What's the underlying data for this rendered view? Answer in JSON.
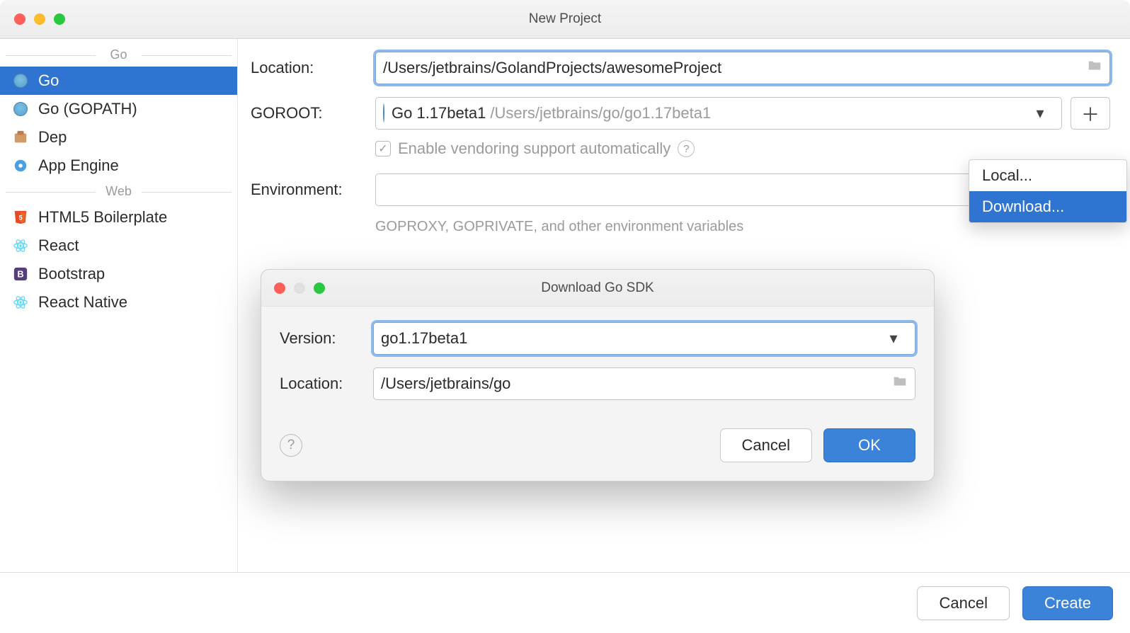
{
  "window": {
    "title": "New Project"
  },
  "sidebar": {
    "groups": [
      {
        "label": "Go",
        "items": [
          {
            "label": "Go",
            "icon": "gopher-icon",
            "selected": true
          },
          {
            "label": "Go (GOPATH)",
            "icon": "gopher-icon"
          },
          {
            "label": "Dep",
            "icon": "dep-icon"
          },
          {
            "label": "App Engine",
            "icon": "appengine-icon"
          }
        ]
      },
      {
        "label": "Web",
        "items": [
          {
            "label": "HTML5 Boilerplate",
            "icon": "html5-icon"
          },
          {
            "label": "React",
            "icon": "react-icon"
          },
          {
            "label": "Bootstrap",
            "icon": "bootstrap-icon"
          },
          {
            "label": "React Native",
            "icon": "react-icon"
          }
        ]
      }
    ]
  },
  "form": {
    "location_label": "Location:",
    "location_value": "/Users/jetbrains/GolandProjects/awesomeProject",
    "goroot_label": "GOROOT:",
    "goroot_value": "Go 1.17beta1",
    "goroot_path": "/Users/jetbrains/go/go1.17beta1",
    "vendoring_label": "Enable vendoring support automatically",
    "environment_label": "Environment:",
    "environment_value": "",
    "env_hint": "GOPROXY, GOPRIVATE, and other environment variables"
  },
  "add_menu": {
    "items": [
      {
        "label": "Local...",
        "selected": false
      },
      {
        "label": "Download...",
        "selected": true
      }
    ]
  },
  "download_dialog": {
    "title": "Download Go SDK",
    "version_label": "Version:",
    "version_value": "go1.17beta1",
    "location_label": "Location:",
    "location_value": "/Users/jetbrains/go",
    "cancel": "Cancel",
    "ok": "OK"
  },
  "footer": {
    "cancel": "Cancel",
    "create": "Create"
  }
}
